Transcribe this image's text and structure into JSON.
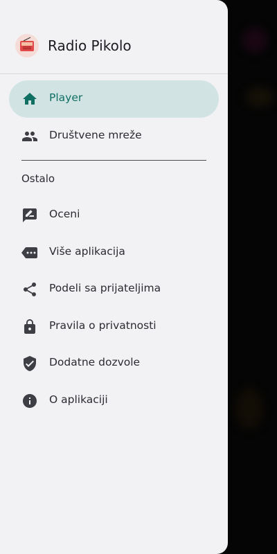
{
  "app": {
    "title": "Radio Pikolo"
  },
  "nav": {
    "primary": [
      {
        "label": "Player",
        "icon": "home-icon",
        "active": true
      },
      {
        "label": "Društvene mreže",
        "icon": "people-icon",
        "active": false
      }
    ],
    "section_title": "Ostalo",
    "secondary": [
      {
        "label": "Oceni",
        "icon": "rate-review-icon"
      },
      {
        "label": "Više aplikacija",
        "icon": "more-tag-icon"
      },
      {
        "label": "Podeli sa prijateljima",
        "icon": "share-icon"
      },
      {
        "label": "Pravila o privatnosti",
        "icon": "lock-icon"
      },
      {
        "label": "Dodatne dozvole",
        "icon": "shield-check-icon"
      },
      {
        "label": "O aplikaciji",
        "icon": "info-icon"
      }
    ]
  },
  "colors": {
    "accent": "#0f6f63",
    "active_pill": "#d1e4e3",
    "icon": "#3e3e45",
    "drawer_bg": "#f2f2f5"
  }
}
